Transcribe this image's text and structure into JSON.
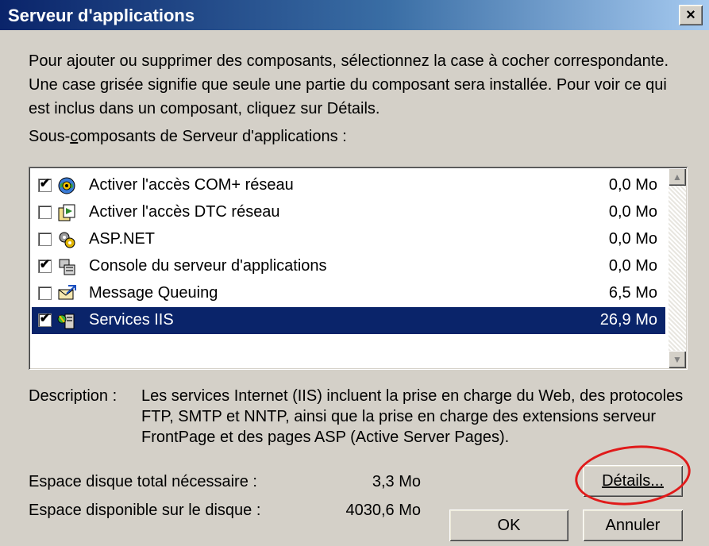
{
  "window": {
    "title": "Serveur d'applications",
    "close_glyph": "×"
  },
  "intro": {
    "text": "Pour ajouter ou supprimer des composants, sélectionnez la case à cocher correspondante. Une case grisée signifie que seule une partie du composant sera installée. Pour voir ce qui est inclus dans un composant, cliquez sur Détails."
  },
  "subtitle": {
    "before": "Sous-",
    "underlined": "c",
    "after": "omposants de Serveur d'applications :"
  },
  "components": [
    {
      "label": "Activer l'accès COM+ réseau",
      "size": "0,0 Mo",
      "checked": true,
      "selected": false,
      "icon": "network-globe-icon"
    },
    {
      "label": "Activer l'accès DTC réseau",
      "size": "0,0 Mo",
      "checked": false,
      "selected": false,
      "icon": "dtc-service-icon"
    },
    {
      "label": "ASP.NET",
      "size": "0,0 Mo",
      "checked": false,
      "selected": false,
      "icon": "gear-icon"
    },
    {
      "label": "Console du serveur d'applications",
      "size": "0,0 Mo",
      "checked": true,
      "selected": false,
      "icon": "console-icon"
    },
    {
      "label": "Message Queuing",
      "size": "6,5 Mo",
      "checked": false,
      "selected": false,
      "icon": "message-envelope-icon"
    },
    {
      "label": "Services IIS",
      "size": "26,9 Mo",
      "checked": true,
      "selected": true,
      "icon": "iis-server-icon"
    }
  ],
  "checkmark": "✔",
  "scrollbar": {
    "up": "▲",
    "down": "▼"
  },
  "description": {
    "label": "Description :",
    "text": "Les services Internet (IIS) incluent la prise en charge du Web, des protocoles FTP, SMTP et NNTP, ainsi que la prise en charge des extensions serveur FrontPage et des pages ASP (Active Server Pages)."
  },
  "disk": {
    "required_label": "Espace disque total nécessaire :",
    "required_value": "3,3 Mo",
    "available_label": "Espace disponible sur le disque :",
    "available_value": "4030,6 Mo"
  },
  "buttons": {
    "details": "Détails...",
    "ok": "OK",
    "cancel": "Annuler"
  },
  "colors": {
    "selection": "#0a246a",
    "annotation": "#e01a1a"
  }
}
